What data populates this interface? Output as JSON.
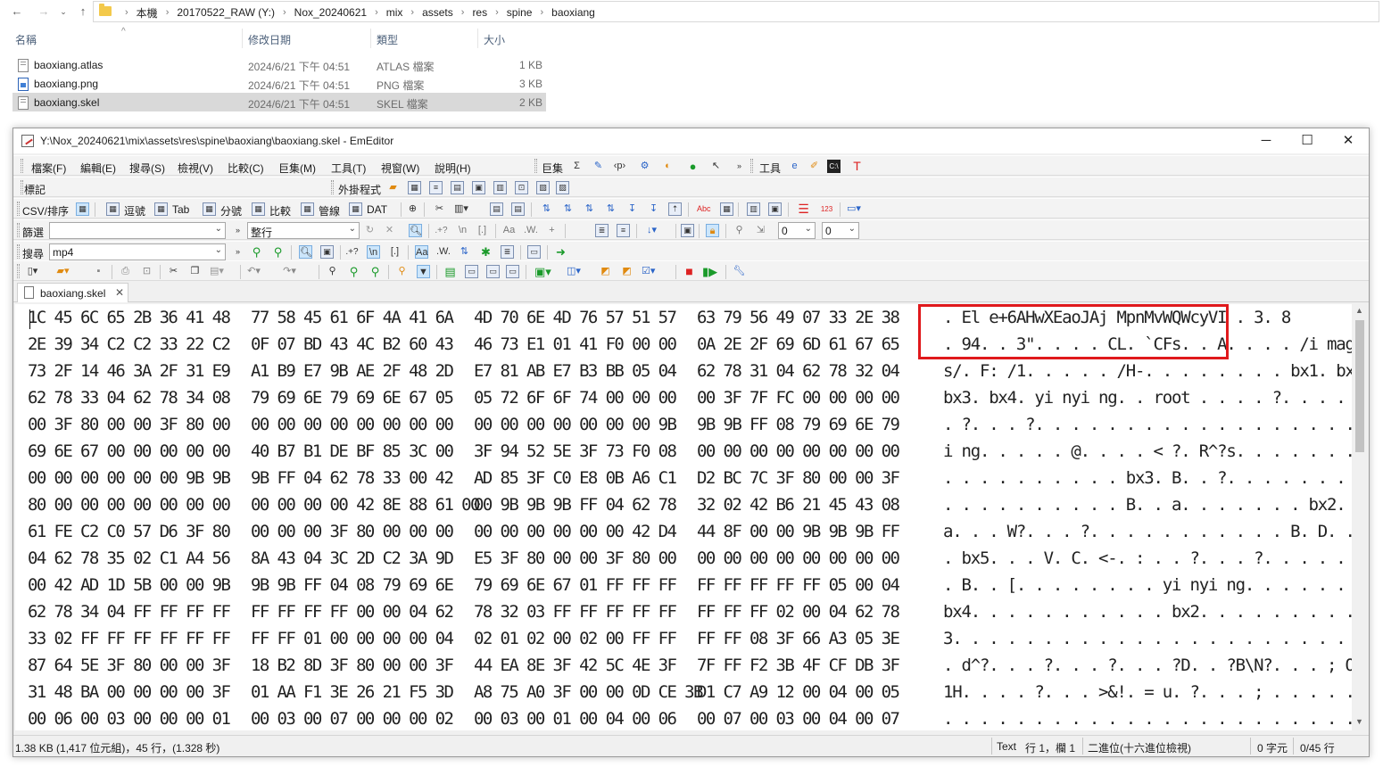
{
  "explorer": {
    "breadcrumbs": [
      "本機",
      "20170522_RAW (Y:)",
      "Nox_20240621",
      "mix",
      "assets",
      "res",
      "spine",
      "baoxiang"
    ],
    "columns": {
      "name": "名稱",
      "date": "修改日期",
      "type": "類型",
      "size": "大小"
    },
    "files": [
      {
        "name": "baoxiang.atlas",
        "date": "2024/6/21 下午 04:51",
        "type": "ATLAS 檔案",
        "size": "1 KB",
        "icon": "document-icon",
        "selected": false
      },
      {
        "name": "baoxiang.png",
        "date": "2024/6/21 下午 04:51",
        "type": "PNG 檔案",
        "size": "3 KB",
        "icon": "image-icon",
        "selected": false
      },
      {
        "name": "baoxiang.skel",
        "date": "2024/6/21 下午 04:51",
        "type": "SKEL 檔案",
        "size": "2 KB",
        "icon": "document-icon",
        "selected": true
      }
    ]
  },
  "editor_window": {
    "title": "Y:\\Nox_20240621\\mix\\assets\\res\\spine\\baoxiang\\baoxiang.skel - EmEditor",
    "menu": [
      "檔案(F)",
      "編輯(E)",
      "搜尋(S)",
      "檢視(V)",
      "比較(C)",
      "巨集(M)",
      "工具(T)",
      "視窗(W)",
      "說明(H)"
    ],
    "macro_label": "巨集",
    "tools_label": "工具",
    "bookmark_label": "標記",
    "plugins_label": "外掛程式",
    "csv_label": "CSV/排序",
    "csv_buttons": [
      "逗號",
      "Tab",
      "分號",
      "比較",
      "管線",
      "DAT"
    ],
    "filter_label": "篩選",
    "filter_mode": "整行",
    "filter_value": "",
    "dropdown_a": "0",
    "dropdown_b": "0",
    "search_label": "搜尋",
    "search_value": "mp4",
    "tab_label": "baoxiang.skel",
    "hex_rows": [
      {
        "hex": [
          "1C 45 6C 65 2B 36 41 48",
          "77 58 45 61 6F 4A 41 6A",
          "4D 70 6E 4D 76 57 51 57",
          "63 79 56 49 07 33 2E 38"
        ],
        "ascii": ". El e+6AHwXEaoJAj MpnMvWQWcyVI . 3. 8"
      },
      {
        "hex": [
          "2E 39 34 C2 C2 33 22 C2",
          "0F 07 BD 43 4C B2 60 43",
          "46 73 E1 01 41 F0 00 00",
          "0A 2E 2F 69 6D 61 67 65"
        ],
        "ascii": ". 94. . 3\". . . . CL. `CFs. . A. . . . /i mage"
      },
      {
        "hex": [
          "73 2F 14 46 3A 2F 31 E9",
          "A1 B9 E7 9B AE 2F 48 2D",
          "E7 81 AB E7 B3 BB 05 04",
          "62 78 31 04 62 78 32 04"
        ],
        "ascii": "s/. F: /1. . . . . /H-. . . . . . . . bx1. bx2."
      },
      {
        "hex": [
          "62 78 33 04 62 78 34 08",
          "79 69 6E 79 69 6E 67 05",
          "05 72 6F 6F 74 00 00 00",
          "00 3F 7F FC 00 00 00 00"
        ],
        "ascii": "bx3. bx4. yi nyi ng. . root . . . . ?. . . . . ."
      },
      {
        "hex": [
          "00 3F 80 00 00 3F 80 00",
          "00 00 00 00 00 00 00 00",
          "00 00 00 00 00 00 00 9B",
          "9B 9B FF 08 79 69 6E 79"
        ],
        "ascii": ". ?. . . ?. . . . . . . . . . . . . . . . . . . yi ny"
      },
      {
        "hex": [
          "69 6E 67 00 00 00 00 00",
          "40 B7 B1 DE BF 85 3C 00",
          "3F 94 52 5E 3F 73 F0 08",
          "00 00 00 00 00 00 00 00"
        ],
        "ascii": "i ng. . . . . @. . . . < ?. R^?s. . . . . . . . ."
      },
      {
        "hex": [
          "00 00 00 00 00 00 9B 9B",
          "9B FF 04 62 78 33 00 42",
          "AD 85 3F C0 E8 0B A6 C1",
          "D2 BC 7C 3F 80 00 00 3F"
        ],
        "ascii": ". . . . . . . . . . bx3. B. . ?. . . . . . . | ?. . . ?"
      },
      {
        "hex": [
          "80 00 00 00 00 00 00 00",
          "00 00 00 00 42 8E 88 61 00",
          "00 9B 9B 9B FF 04 62 78",
          "32 02 42 B6 21 45 43 08"
        ],
        "ascii": ". . . . . . . . . . B. . a. . . . . . . bx2. B. ! EC."
      },
      {
        "hex": [
          "61 FE C2 C0 57 D6 3F 80",
          "00 00 00 3F 80 00 00 00",
          "00 00 00 00 00 00 42 D4",
          "44 8F 00 00 9B 9B 9B FF"
        ],
        "ascii": "a. . . W?. . . ?. . . . . . . . . . . B. D. . . . . ."
      },
      {
        "hex": [
          "04 62 78 35 02 C1 A4 56",
          "8A 43 04 3C 2D C2 3A 9D",
          "E5 3F 80 00 00 3F 80 00",
          "00 00 00 00 00 00 00 00"
        ],
        "ascii": ". bx5. . . V. C. <-. : . . ?. . . ?. . . . . . . . . ."
      },
      {
        "hex": [
          "00 42 AD 1D 5B 00 00 9B",
          "9B 9B FF 04 08 79 69 6E",
          "79 69 6E 67 01 FF FF FF",
          "FF FF FF FF FF 05 00 04"
        ],
        "ascii": ". B. . [. . . . . . . . yi nyi ng. . . . . . . . . . . ."
      },
      {
        "hex": [
          "62 78 34 04 FF FF FF FF",
          "FF FF FF FF 00 00 04 62",
          "78 32 03 FF FF FF FF FF",
          "FF FF FF 02 00 04 62 78"
        ],
        "ascii": "bx4. . . . . . . . . . . bx2. . . . . . . . . . . . bx"
      },
      {
        "hex": [
          "33 02 FF FF FF FF FF FF",
          "FF FF 01 00 00 00 00 04",
          "02 01 02 00 02 00 FF FF",
          "FF FF 08 3F 66 A3 05 3E"
        ],
        "ascii": "3. . . . . . . . . . . . . . . . . . . . . . . . . . ?f. . >"
      },
      {
        "hex": [
          "87 64 5E 3F 80 00 00 3F",
          "18 B2 8D 3F 80 00 00 3F",
          "44 EA 8E 3F 42 5C 4E 3F",
          "7F FF F2 3B 4F CF DB 3F"
        ],
        "ascii": ". d^?. . . ?. . . ?. . . ?D. . ?B\\N?. . . ; O. . ?"
      },
      {
        "hex": [
          "31 48 BA 00 00 00 00 3F",
          "01 AA F1 3E 26 21 F5 3D",
          "A8 75 A0 3F 00 00 0D CE 3B",
          "D1 C7 A9 12 00 04 00 05"
        ],
        "ascii": "1H. . . . ?. . . >&!. = u. ?. . . ; . . . . . . . . ."
      },
      {
        "hex": [
          "00 06 00 03 00 00 00 01",
          "00 03 00 07 00 00 00 02",
          "00 03 00 01 00 04 00 06",
          "00 07 00 03 00 04 00 07"
        ],
        "ascii": ". . . . . . . . . . . . . . . . . . . . . . . . . . . . . . . ."
      }
    ],
    "status": {
      "size": "1.38 KB (1,417 位元組)，45 行，(1.328 秒)",
      "mode": "Text",
      "position": "行 1，欄 1",
      "encoding": "二進位(十六進位檢視)",
      "selection": "0 字元",
      "lines": "0/45 行"
    }
  }
}
